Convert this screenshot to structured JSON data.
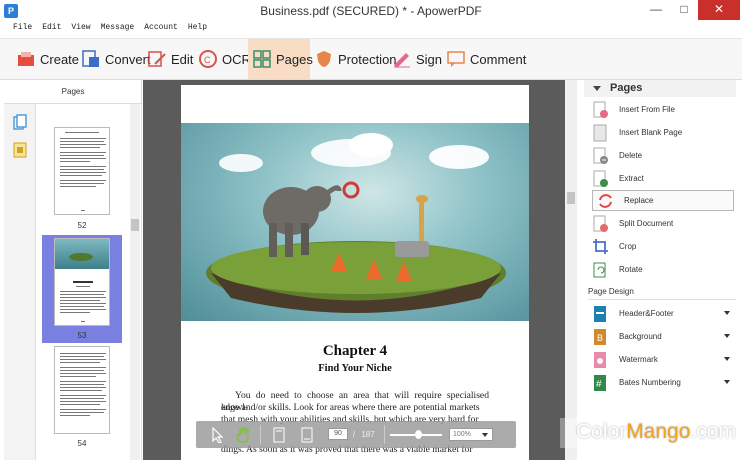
{
  "window": {
    "title": "Business.pdf (SECURED) * - ApowerPDF",
    "app_icon_letter": "P"
  },
  "menu": [
    "File",
    "Edit",
    "View",
    "Message",
    "Account",
    "Help"
  ],
  "toolbar": {
    "items": [
      {
        "label": "Create",
        "icon": "create-icon"
      },
      {
        "label": "Convert",
        "icon": "convert-icon"
      },
      {
        "label": "Edit",
        "icon": "edit-icon"
      },
      {
        "label": "OCR",
        "icon": "ocr-icon"
      },
      {
        "label": "Pages",
        "icon": "pages-icon",
        "active": true
      },
      {
        "label": "Protection",
        "icon": "shield-icon"
      },
      {
        "label": "Sign",
        "icon": "sign-icon"
      },
      {
        "label": "Comment",
        "icon": "comment-icon"
      }
    ]
  },
  "left_panel": {
    "header": "Pages",
    "thumbnails": [
      {
        "page": "52"
      },
      {
        "page": "53",
        "selected": true
      },
      {
        "page": "54"
      }
    ]
  },
  "document": {
    "chapter_title": "Chapter 4",
    "chapter_subtitle": "Find Your Niche",
    "paragraph_lines": [
      "You do need to choose an area that will require specialised knowl-",
      "edge and/or skills. Look for areas where there are potential markets",
      "that mesh with your abilities and skills, but which are very hard for",
      "dings. As soon as it was proved that there was a viable market for"
    ]
  },
  "bottom_bar": {
    "current_page": "90",
    "separator": "/",
    "total_pages": "187",
    "zoom": "100%"
  },
  "right_panel": {
    "header": "Pages",
    "items": [
      {
        "label": "Insert From File",
        "icon": "insert-file-icon"
      },
      {
        "label": "Insert Blank Page",
        "icon": "blank-page-icon"
      },
      {
        "label": "Delete",
        "icon": "delete-page-icon"
      },
      {
        "label": "Extract",
        "icon": "extract-page-icon"
      },
      {
        "label": "Replace",
        "icon": "replace-icon",
        "highlighted": true
      },
      {
        "label": "Split Document",
        "icon": "split-document-icon"
      },
      {
        "label": "Crop",
        "icon": "crop-icon"
      },
      {
        "label": "Rotate",
        "icon": "rotate-icon"
      }
    ],
    "design_section": "Page Design",
    "design_items": [
      {
        "label": "Header&Footer",
        "icon": "header-footer-icon"
      },
      {
        "label": "Background",
        "icon": "background-icon"
      },
      {
        "label": "Watermark",
        "icon": "watermark-icon"
      },
      {
        "label": "Bates Numbering",
        "icon": "bates-numbering-icon"
      }
    ]
  },
  "watermark": {
    "part1": "Color",
    "part2": "Mango",
    "part3": ".com"
  },
  "colors": {
    "accent": "#f8dcc4",
    "selection": "#7a80e0",
    "close": "#c9302c"
  }
}
